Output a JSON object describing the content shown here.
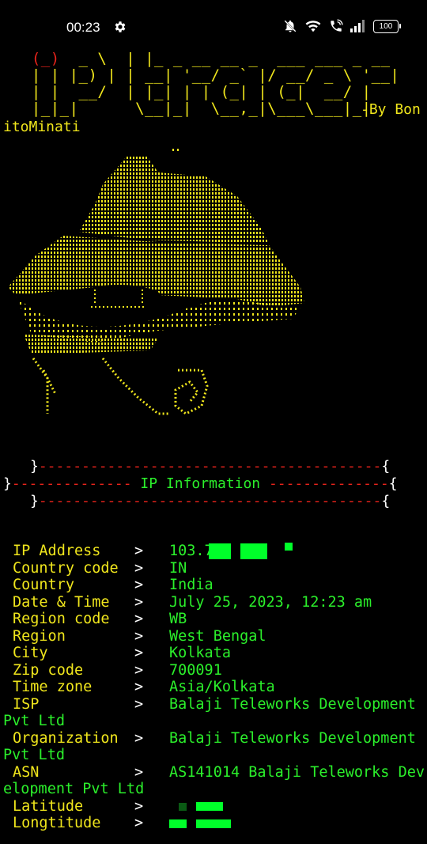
{
  "status_bar": {
    "time": "00:23",
    "battery": "100",
    "icons": [
      "settings-gear-icon",
      "mute-bell-icon",
      "wifi-icon",
      "wifi-calling-icon",
      "signal-icon",
      "battery-icon"
    ]
  },
  "banner": {
    "credit_part1": "-By Bon",
    "credit_part2": "itoMinati"
  },
  "section": {
    "title": "IP Information"
  },
  "info": {
    "rows": [
      {
        "key": "IP Address",
        "arrow": ">",
        "value": "103.7"
      },
      {
        "key": "Country code",
        "arrow": ">",
        "value": "IN"
      },
      {
        "key": "Country",
        "arrow": ">",
        "value": "India"
      },
      {
        "key": "Date & Time",
        "arrow": ">",
        "value": "July 25, 2023, 12:23 am"
      },
      {
        "key": "Region code",
        "arrow": ">",
        "value": "WB"
      },
      {
        "key": "Region",
        "arrow": ">",
        "value": "West Bengal"
      },
      {
        "key": "City",
        "arrow": ">",
        "value": "Kolkata"
      },
      {
        "key": "Zip code",
        "arrow": ">",
        "value": "700091"
      },
      {
        "key": "Time zone",
        "arrow": ">",
        "value": "Asia/Kolkata"
      },
      {
        "key": "ISP",
        "arrow": ">",
        "value": "Balaji Teleworks Development",
        "wrap": "Pvt Ltd"
      },
      {
        "key": "Organization",
        "arrow": ">",
        "value": "Balaji Teleworks Development",
        "wrap": "Pvt Ltd"
      },
      {
        "key": "ASN",
        "arrow": ">",
        "value": "AS141014 Balaji Teleworks Dev",
        "wrap": "elopment Pvt Ltd"
      },
      {
        "key": "Latitude",
        "arrow": ">",
        "value": ""
      },
      {
        "key": "Longtitude",
        "arrow": ">",
        "value": ""
      }
    ]
  },
  "colors": {
    "yellow": "#f0e61c",
    "green": "#2bef2b",
    "red": "#e8231b",
    "background": "#000000"
  }
}
